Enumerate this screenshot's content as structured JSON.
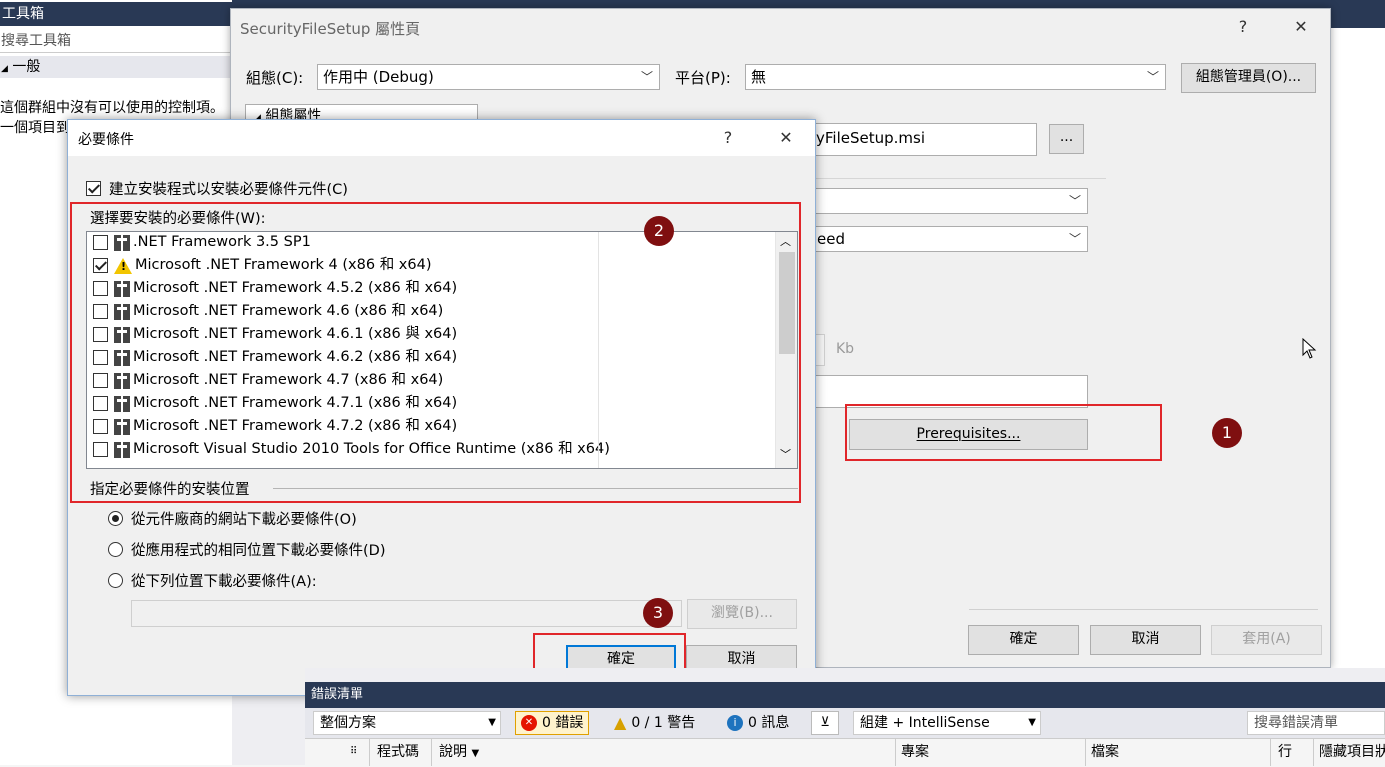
{
  "ide": {
    "toolbox_title": "工具箱",
    "toolbox_search_placeholder": "搜尋工具箱",
    "toolbox_group": "一般",
    "toolbox_msg_line1": "這個群組中沒有可以使用的控制項。",
    "toolbox_msg_line2": "一個項目到"
  },
  "property_dialog": {
    "title": "SecurityFileSetup 屬性頁",
    "help_label": "?",
    "close_label": "✕",
    "config_label": "組態(C):",
    "config_value": "作用中 (Debug)",
    "platform_label": "平台(P):",
    "platform_value": "無",
    "config_manager_button": "組態管理員(O)...",
    "tree_item": "組態屬性",
    "output_file_partial": "yFileSetup.msi",
    "browse_button": "...",
    "combo2_partial": "eed",
    "size_unit": "Kb",
    "prerequisites_button": "Prerequisites...",
    "ok_button": "確定",
    "cancel_button": "取消",
    "apply_button": "套用(A)"
  },
  "prereq_dialog": {
    "title": "必要條件",
    "help_label": "?",
    "close_label": "✕",
    "create_setup_label": "建立安裝程式以安裝必要條件元件(C)",
    "choose_label": "選擇要安裝的必要條件(W):",
    "items": [
      {
        "label": ".NET Framework 3.5 SP1",
        "checked": false,
        "icon": "package-icon"
      },
      {
        "label": "Microsoft .NET Framework 4 (x86 和 x64)",
        "checked": true,
        "icon": "warning-icon"
      },
      {
        "label": "Microsoft .NET Framework 4.5.2 (x86 和 x64)",
        "checked": false,
        "icon": "package-icon"
      },
      {
        "label": "Microsoft .NET Framework 4.6 (x86 和 x64)",
        "checked": false,
        "icon": "package-icon"
      },
      {
        "label": "Microsoft .NET Framework 4.6.1 (x86 與 x64)",
        "checked": false,
        "icon": "package-icon"
      },
      {
        "label": "Microsoft .NET Framework 4.6.2 (x86 和 x64)",
        "checked": false,
        "icon": "package-icon"
      },
      {
        "label": "Microsoft .NET Framework 4.7 (x86 和 x64)",
        "checked": false,
        "icon": "package-icon"
      },
      {
        "label": "Microsoft .NET Framework 4.7.1 (x86 和 x64)",
        "checked": false,
        "icon": "package-icon"
      },
      {
        "label": "Microsoft .NET Framework 4.7.2 (x86 和 x64)",
        "checked": false,
        "icon": "package-icon"
      },
      {
        "label": "Microsoft Visual Studio 2010 Tools for Office Runtime (x86 和 x64)",
        "checked": false,
        "icon": "package-icon"
      }
    ],
    "location_label": "指定必要條件的安裝位置",
    "radio_vendor": "從元件廠商的網站下載必要條件(O)",
    "radio_same": "從應用程式的相同位置下載必要條件(D)",
    "radio_custom": "從下列位置下載必要條件(A):",
    "browse_button": "瀏覽(B)...",
    "ok_button": "確定",
    "cancel_button": "取消"
  },
  "annotations": {
    "marker1": "1",
    "marker2": "2",
    "marker3": "3"
  },
  "error_list": {
    "title": "錯誤清單",
    "scope": "整個方案",
    "errors": "0 錯誤",
    "warnings": "0 / 1 警告",
    "messages": "0 訊息",
    "build_filter": "組建 + IntelliSense",
    "search_placeholder": "搜尋錯誤清單",
    "col_code": "程式碼",
    "col_desc": "說明",
    "col_project": "專案",
    "col_file": "檔案",
    "col_line": "行",
    "col_suppress": "隱藏項目狀"
  },
  "colors": {
    "annotation_red": "#e0262a",
    "marker_fill": "#7f0f10",
    "accent": "#0078d7"
  }
}
